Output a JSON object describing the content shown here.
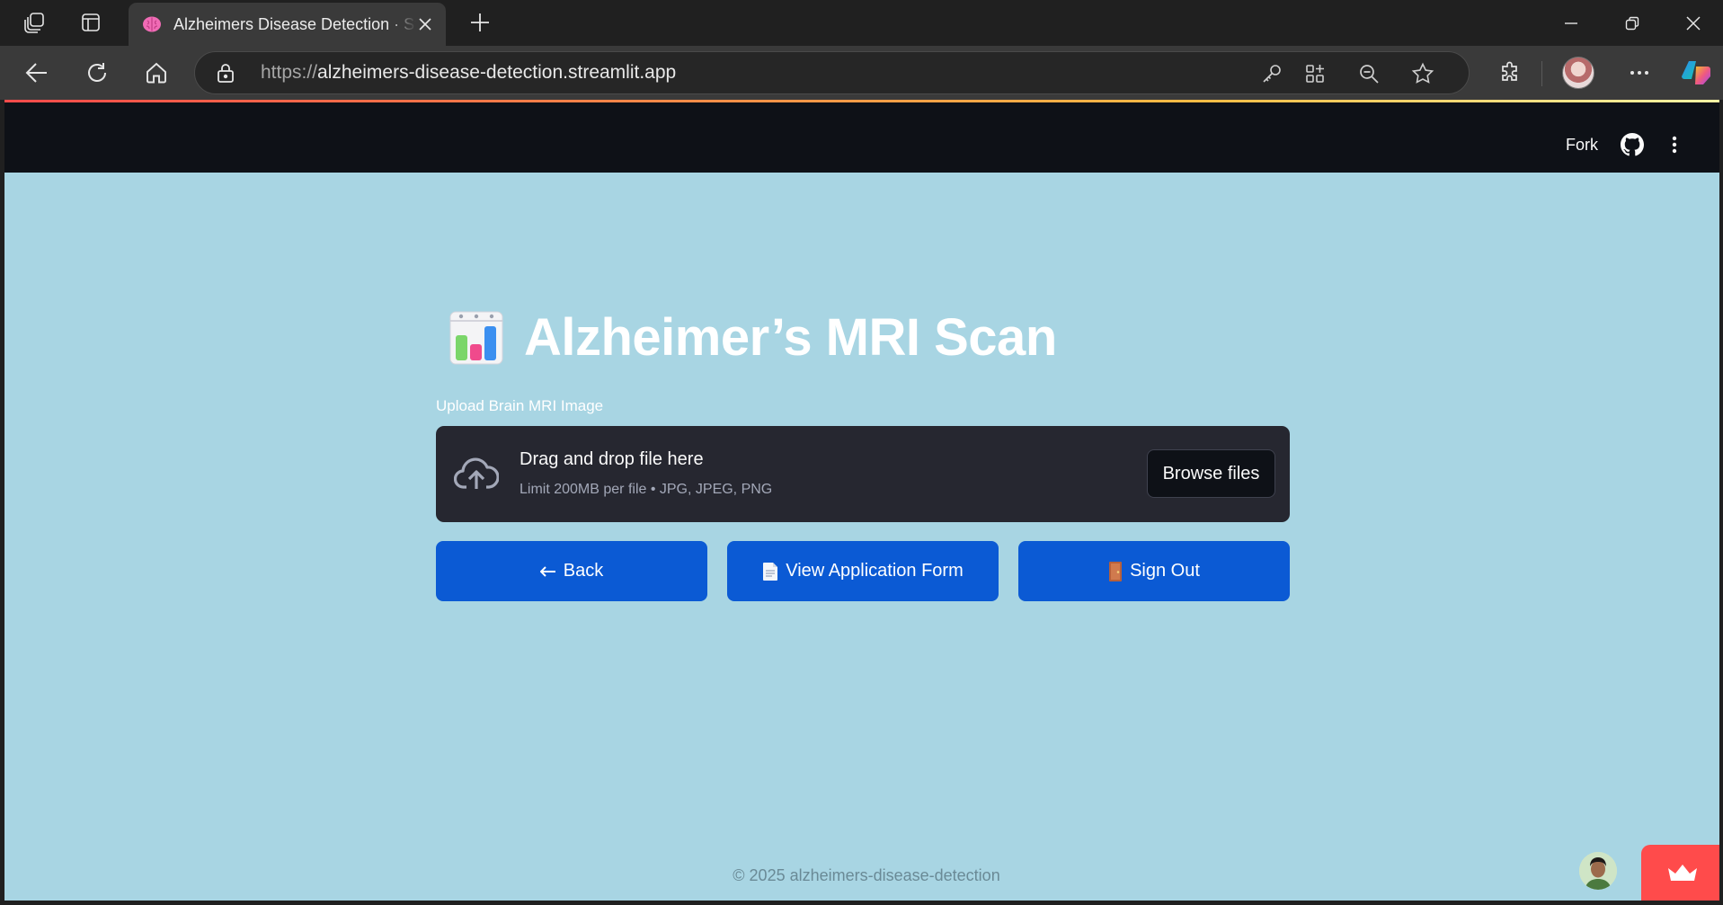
{
  "browser": {
    "tab": {
      "title": "Alzheimers Disease Detection · Streamlit",
      "favicon": "brain-icon"
    },
    "address": {
      "protocol": "https://",
      "host": "alzheimers-disease-detection.streamlit.app"
    },
    "icons": [
      "workspaces-icon",
      "vertical-tabs-icon",
      "new-tab-icon",
      "minimize-icon",
      "restore-icon",
      "close-icon",
      "back-icon",
      "refresh-icon",
      "home-icon",
      "lock-icon",
      "key-icon",
      "app-grid-icon",
      "zoom-out-icon",
      "favorite-star-icon",
      "extensions-icon",
      "profile-avatar",
      "more-icon",
      "copilot-icon"
    ]
  },
  "streamlit_header": {
    "fork_label": "Fork",
    "github_icon": "github-icon",
    "menu_icon": "kebab-menu-icon",
    "accent": "#ff4b4b"
  },
  "page": {
    "title": "Alzheimer’s MRI Scan",
    "title_emoji": "bar-chart-icon",
    "background": "#a8d5e3"
  },
  "uploader": {
    "label": "Upload Brain MRI Image",
    "drop_title": "Drag and drop file here",
    "drop_subtitle": "Limit 200MB per file • JPG, JPEG, PNG",
    "browse_label": "Browse files",
    "icon": "cloud-upload-icon"
  },
  "buttons": [
    {
      "label": "Back",
      "icon": "left-arrow-icon"
    },
    {
      "label": "View Application Form",
      "icon": "document-icon"
    },
    {
      "label": "Sign Out",
      "icon": "door-icon"
    }
  ],
  "button_color": "#0b5ad4",
  "footer": {
    "text": "© 2025 alzheimers-disease-detection"
  }
}
